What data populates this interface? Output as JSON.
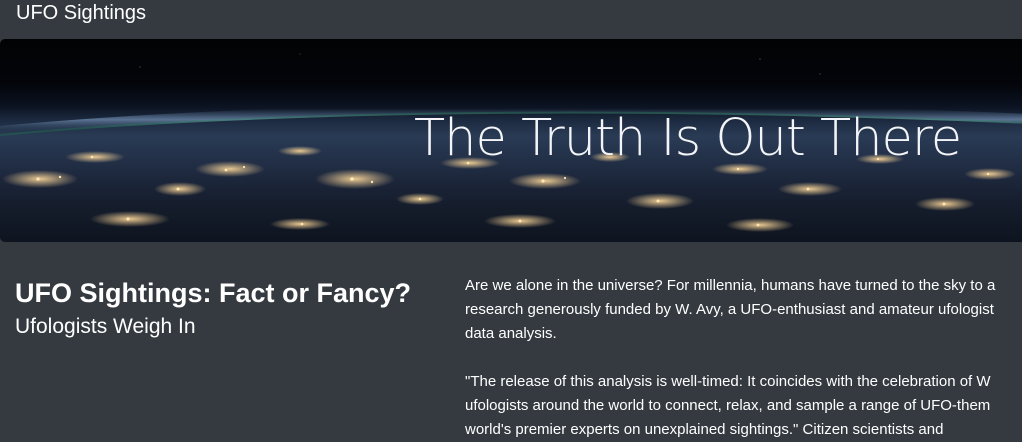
{
  "navbar": {
    "brand": "UFO Sightings"
  },
  "hero": {
    "title": "The Truth Is Out There"
  },
  "main": {
    "heading": "UFO Sightings: Fact or Fancy?",
    "subheading": "Ufologists Weigh In",
    "paragraphs": [
      {
        "lines": [
          "Are we alone in the universe? For millennia, humans have turned to the sky to a",
          "research generously funded by W. Avy, a UFO-enthusiast and amateur ufologist",
          "data analysis."
        ]
      },
      {
        "lines": [
          "\"The release of this analysis is well-timed: It coincides with the celebration of W",
          "ufologists around the world to connect, relax, and sample a range of UFO-them",
          "world's premier experts on unexplained sightings.\" Citizen scientists and"
        ]
      }
    ]
  }
}
